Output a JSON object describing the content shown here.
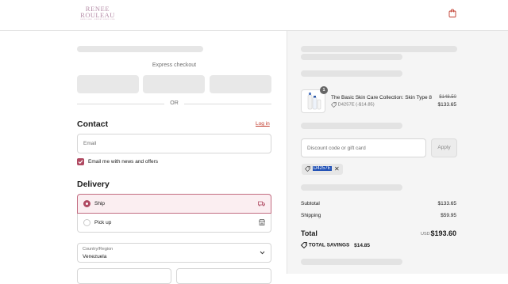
{
  "header": {
    "logo_line1": "RENEE",
    "logo_line2": "ROULEAU",
    "logo_tagline": "SKIN CARE · EXPERT SINCE 1985",
    "icons": [
      "bag-icon"
    ]
  },
  "express_checkout": {
    "label": "Express checkout",
    "divider": "OR"
  },
  "contact": {
    "heading": "Contact",
    "login_link": "Log in",
    "email_placeholder": "Email",
    "newsletter_label": "Email me with news and offers",
    "newsletter_checked": true
  },
  "delivery": {
    "heading": "Delivery",
    "options": [
      {
        "label": "Ship",
        "selected": true,
        "icon": "truck-icon"
      },
      {
        "label": "Pick up",
        "selected": false,
        "icon": "store-icon"
      }
    ],
    "country_label": "Country/Region",
    "country_value": "Venezuela"
  },
  "summary": {
    "item": {
      "quantity": "1",
      "name": "The Basic Skin Care Collection: Skin Type 8",
      "discount": "D4257E (-$14.85)",
      "original_price": "$148.50",
      "price": "$133.65"
    },
    "discount_placeholder": "Discount code or gift card",
    "apply_label": "Apply",
    "applied_code": "D4257E",
    "subtotal_label": "Subtotal",
    "subtotal_value": "$133.65",
    "shipping_label": "Shipping",
    "shipping_value": "$59.95",
    "total_label": "Total",
    "total_currency": "USD",
    "total_value": "$193.60",
    "savings_label": "TOTAL SAVINGS",
    "savings_value": "$14.85"
  },
  "colors": {
    "accent": "#b04a62",
    "link": "#c0392b",
    "selected_bg": "#fbeef1",
    "panel_bg": "#f5f5f5"
  }
}
